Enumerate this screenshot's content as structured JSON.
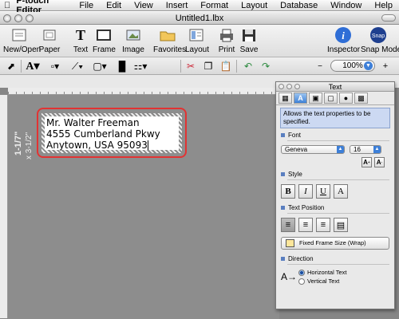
{
  "menubar": {
    "app_name": "P-touch Editor",
    "items": [
      "File",
      "Edit",
      "View",
      "Insert",
      "Format",
      "Layout",
      "Database",
      "Window",
      "Help"
    ]
  },
  "window": {
    "title": "Untitled1.lbx"
  },
  "toolbar": {
    "new_open": "New/Open",
    "paper": "Paper",
    "text": "Text",
    "frame": "Frame",
    "image": "Image",
    "favorites": "Favorites",
    "layout": "Layout",
    "print": "Print",
    "save": "Save",
    "inspector": "Inspector",
    "snap_mode": "Snap Mode"
  },
  "toolbar2": {
    "zoom": "100%"
  },
  "canvas": {
    "tape_length": "1-1/7\"",
    "tape_width": "x 3-1/2\"",
    "label_lines": [
      "Mr. Walter Freeman",
      "4555 Cumberland Pkwy",
      "Anytown, USA 95093"
    ]
  },
  "inspector": {
    "title": "Text",
    "help": "Allows the text properties to be specified.",
    "font_section": "Font",
    "font_name": "Geneva",
    "font_size": "16",
    "style_section": "Style",
    "style_buttons": [
      "B",
      "I",
      "U",
      "A"
    ],
    "text_position_section": "Text Position",
    "fixed_frame": "Fixed Frame Size (Wrap)",
    "direction_section": "Direction",
    "direction_options": [
      "Horizontal Text",
      "Vertical Text"
    ],
    "direction_selected": "Horizontal Text"
  },
  "colors": {
    "highlight_outline": "#e23333",
    "selection_blue": "#3e82d8",
    "canvas_bg": "#868686"
  }
}
